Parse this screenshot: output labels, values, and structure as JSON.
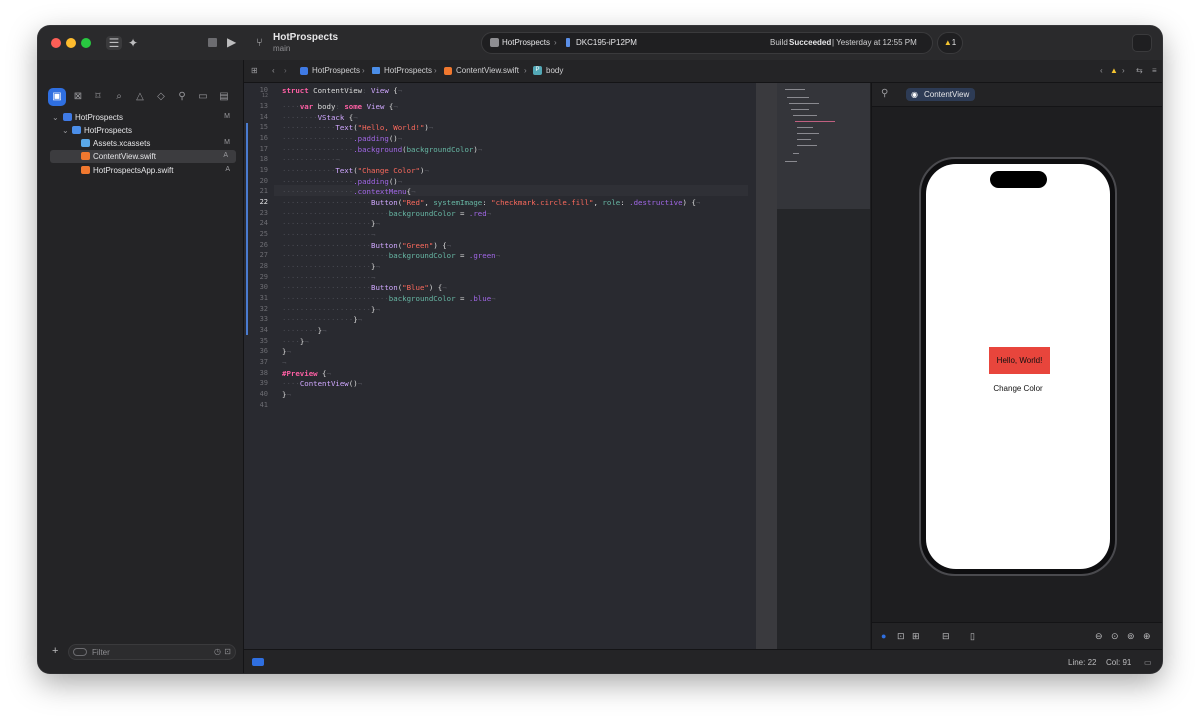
{
  "toolbar": {
    "project": "HotProspects",
    "branch": "main",
    "scheme": "HotProspects",
    "destination": "DKC195-iP12PM",
    "build_status_prefix": "Build ",
    "build_status_bold": "Succeeded",
    "build_status_time": " | Yesterday at 12:55 PM",
    "warning_count": "1"
  },
  "navigator": {
    "items": [
      {
        "label": "HotProspects",
        "status": "M"
      },
      {
        "label": "HotProspects",
        "status": ""
      },
      {
        "label": "Assets.xcassets",
        "status": "M"
      },
      {
        "label": "ContentView.swift",
        "status": "A"
      },
      {
        "label": "HotProspectsApp.swift",
        "status": "A"
      }
    ],
    "filter_placeholder": "Filter"
  },
  "jumpbar": {
    "crumbs": [
      "HotProspects",
      "HotProspects",
      "ContentView.swift",
      "body"
    ]
  },
  "editor": {
    "current_line": "22",
    "line_numbers": [
      "10",
      "12",
      "13",
      "14",
      "15",
      "16",
      "17",
      "18",
      "19",
      "20",
      "21",
      "22",
      "23",
      "24",
      "25",
      "26",
      "27",
      "28",
      "29",
      "30",
      "31",
      "32",
      "33",
      "34",
      "35",
      "36",
      "37",
      "38",
      "39",
      "40",
      "41"
    ]
  },
  "canvas": {
    "preview_name": "ContentView",
    "hello_text": "Hello, World!",
    "change_text": "Change Color",
    "hello_color": "#e8453c"
  },
  "status": {
    "line": "Line: 22",
    "col": "Col: 91"
  },
  "colors": {
    "accent": "#2f6fe0",
    "keyword": "#fc5fa3",
    "string": "#fc6a5d"
  }
}
